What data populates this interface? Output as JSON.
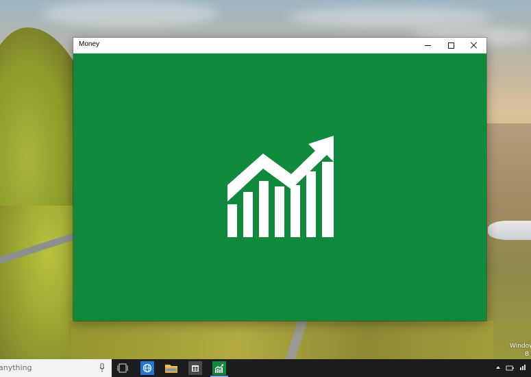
{
  "window": {
    "title": "Money",
    "minimize_label": "Minimize",
    "maximize_label": "Maximize",
    "close_label": "Close",
    "splash_color": "#0f8a3c"
  },
  "desktop": {
    "watermark_line1": "Window",
    "watermark_line2": "B"
  },
  "taskbar": {
    "search_text": "anything",
    "apps": [
      {
        "name": "edge-browser",
        "color": "#1e78d7"
      },
      {
        "name": "file-explorer",
        "color": "#f2c14e"
      },
      {
        "name": "store",
        "color": "#4a4a4a"
      },
      {
        "name": "money",
        "color": "#0f8a3c"
      }
    ]
  }
}
